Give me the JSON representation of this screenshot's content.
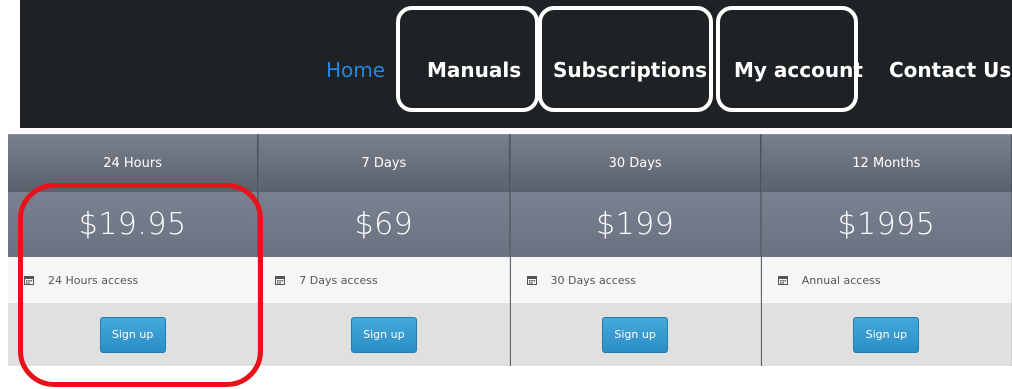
{
  "nav": {
    "items": [
      {
        "label": "Home",
        "active": true
      },
      {
        "label": "Manuals",
        "active": false
      },
      {
        "label": "Subscriptions",
        "active": false
      },
      {
        "label": "My account",
        "active": false
      },
      {
        "label": "Contact Us",
        "active": false
      }
    ]
  },
  "plans": [
    {
      "duration": "24 Hours",
      "price": "$19.95",
      "feature": "24 Hours access",
      "action": "Sign up"
    },
    {
      "duration": "7 Days",
      "price": "$69",
      "feature": "7 Days access",
      "action": "Sign up"
    },
    {
      "duration": "30 Days",
      "price": "$199",
      "feature": "30 Days access",
      "action": "Sign up"
    },
    {
      "duration": "12 Months",
      "price": "$1995",
      "feature": "Annual access",
      "action": "Sign up"
    }
  ],
  "colors": {
    "nav_bg": "#1e2224",
    "nav_active": "#1e88e5",
    "annotation_white": "#ffffff",
    "annotation_red": "#e8121b",
    "button": "#2b8fc6"
  },
  "icons": {
    "feature": "calendar-icon"
  }
}
